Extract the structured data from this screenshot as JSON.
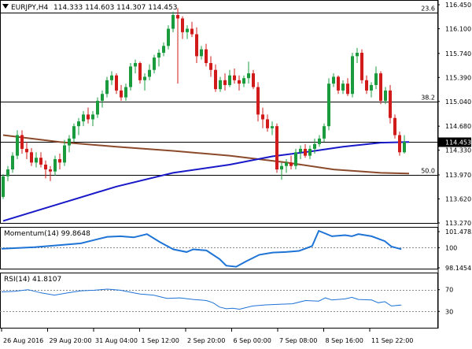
{
  "header": {
    "symbol": "EURJPY,H4",
    "ohlc": "114.333 114.603 114.307 114.453"
  },
  "colors": {
    "bull": "#1a9c3e",
    "bear": "#d11a1a",
    "ma_fast": "#1919c8",
    "ma_slow": "#8b4a2b",
    "indicator": "#1e73d6",
    "grid_line": "#000000",
    "dotted": "#8a8a8a",
    "price_tag_bg": "#000000",
    "price_tag_fg": "#ffffff"
  },
  "chart_data": [
    {
      "type": "candlestick",
      "panel": "price",
      "symbol": "EURJPY",
      "timeframe": "H4",
      "current_price": "114.453",
      "y_ticks": [
        "116.450",
        "116.100",
        "115.740",
        "115.390",
        "115.040",
        "114.680",
        "114.330",
        "113.970",
        "113.620",
        "113.270"
      ],
      "ylim": [
        113.27,
        116.45
      ],
      "x_ticks": [
        "26 Aug 2016",
        "29 Aug 20:00",
        "31 Aug 04:00",
        "1 Sep 12:00",
        "2 Sep 20:00",
        "6 Sep 00:00",
        "7 Sep 08:00",
        "8 Sep 16:00",
        "11 Sep 22:00"
      ],
      "fib_levels": [
        {
          "label": "23.6",
          "value": 116.33
        },
        {
          "label": "38.2",
          "value": 115.04
        },
        {
          "label": "50.0",
          "value": 113.97
        }
      ],
      "hline": 114.453,
      "candles": [
        [
          113.65,
          113.98,
          113.62,
          113.95
        ],
        [
          113.95,
          114.1,
          113.88,
          114.05
        ],
        [
          114.05,
          114.3,
          114.0,
          114.25
        ],
        [
          114.25,
          114.62,
          114.2,
          114.55
        ],
        [
          114.55,
          114.62,
          114.28,
          114.35
        ],
        [
          114.35,
          114.45,
          114.2,
          114.3
        ],
        [
          114.3,
          114.36,
          114.1,
          114.15
        ],
        [
          114.15,
          114.3,
          114.08,
          114.22
        ],
        [
          114.22,
          114.3,
          114.08,
          114.12
        ],
        [
          114.12,
          114.18,
          113.92,
          114.05
        ],
        [
          114.05,
          114.1,
          113.88,
          114.02
        ],
        [
          114.02,
          114.25,
          113.96,
          114.2
        ],
        [
          114.2,
          114.28,
          114.05,
          114.15
        ],
        [
          114.15,
          114.48,
          114.1,
          114.4
        ],
        [
          114.4,
          114.55,
          114.3,
          114.5
        ],
        [
          114.5,
          114.72,
          114.45,
          114.68
        ],
        [
          114.68,
          114.8,
          114.55,
          114.75
        ],
        [
          114.75,
          114.9,
          114.68,
          114.85
        ],
        [
          114.85,
          114.95,
          114.72,
          114.78
        ],
        [
          114.78,
          114.9,
          114.68,
          114.85
        ],
        [
          114.85,
          115.1,
          114.8,
          115.05
        ],
        [
          115.05,
          115.2,
          114.95,
          115.15
        ],
        [
          115.15,
          115.4,
          115.1,
          115.35
        ],
        [
          115.35,
          115.48,
          115.28,
          115.42
        ],
        [
          115.42,
          115.45,
          115.15,
          115.2
        ],
        [
          115.2,
          115.28,
          115.05,
          115.1
        ],
        [
          115.1,
          115.3,
          115.05,
          115.25
        ],
        [
          115.25,
          115.6,
          115.2,
          115.55
        ],
        [
          115.55,
          115.65,
          115.45,
          115.6
        ],
        [
          115.6,
          115.62,
          115.3,
          115.35
        ],
        [
          115.35,
          115.45,
          115.2,
          115.4
        ],
        [
          115.4,
          115.58,
          115.35,
          115.5
        ],
        [
          115.5,
          115.72,
          115.45,
          115.68
        ],
        [
          115.68,
          115.8,
          115.55,
          115.75
        ],
        [
          115.75,
          115.9,
          115.7,
          115.85
        ],
        [
          115.85,
          116.15,
          115.8,
          116.1
        ],
        [
          116.1,
          116.35,
          116.05,
          116.3
        ],
        [
          116.3,
          116.4,
          115.3,
          116.25
        ],
        [
          116.25,
          116.28,
          115.95,
          116.05
        ],
        [
          116.05,
          116.15,
          115.95,
          116.1
        ],
        [
          116.1,
          116.2,
          115.98,
          116.02
        ],
        [
          116.02,
          116.12,
          115.6,
          115.7
        ],
        [
          115.7,
          115.85,
          115.65,
          115.8
        ],
        [
          115.8,
          115.88,
          115.55,
          115.6
        ],
        [
          115.6,
          115.7,
          115.4,
          115.5
        ],
        [
          115.5,
          115.58,
          115.18,
          115.22
        ],
        [
          115.22,
          115.4,
          115.18,
          115.35
        ],
        [
          115.35,
          115.45,
          115.2,
          115.28
        ],
        [
          115.28,
          115.5,
          115.25,
          115.42
        ],
        [
          115.42,
          115.52,
          115.3,
          115.35
        ],
        [
          115.35,
          115.42,
          115.2,
          115.3
        ],
        [
          115.3,
          115.42,
          115.25,
          115.38
        ],
        [
          115.38,
          115.62,
          115.3,
          115.45
        ],
        [
          115.45,
          115.5,
          115.22,
          115.25
        ],
        [
          115.25,
          115.32,
          114.75,
          114.85
        ],
        [
          114.85,
          114.95,
          114.65,
          114.78
        ],
        [
          114.78,
          114.85,
          114.6,
          114.65
        ],
        [
          114.65,
          114.75,
          114.55,
          114.68
        ],
        [
          114.68,
          114.72,
          114.0,
          114.05
        ],
        [
          114.05,
          114.15,
          113.9,
          114.1
        ],
        [
          114.1,
          114.2,
          114.0,
          114.15
        ],
        [
          114.15,
          114.25,
          114.05,
          114.1
        ],
        [
          114.1,
          114.35,
          114.05,
          114.3
        ],
        [
          114.3,
          114.4,
          114.2,
          114.35
        ],
        [
          114.35,
          114.42,
          114.22,
          114.25
        ],
        [
          114.25,
          114.4,
          114.2,
          114.35
        ],
        [
          114.35,
          114.5,
          114.28,
          114.42
        ],
        [
          114.42,
          114.55,
          114.38,
          114.5
        ],
        [
          114.5,
          114.72,
          114.45,
          114.68
        ],
        [
          114.68,
          115.38,
          114.62,
          115.3
        ],
        [
          115.3,
          115.45,
          115.25,
          115.4
        ],
        [
          115.4,
          115.42,
          115.15,
          115.2
        ],
        [
          115.2,
          115.35,
          115.15,
          115.3
        ],
        [
          115.3,
          115.38,
          115.12,
          115.15
        ],
        [
          115.15,
          115.75,
          115.1,
          115.7
        ],
        [
          115.7,
          115.82,
          115.6,
          115.75
        ],
        [
          115.75,
          115.8,
          115.3,
          115.35
        ],
        [
          115.35,
          115.42,
          115.15,
          115.2
        ],
        [
          115.2,
          115.32,
          115.1,
          115.28
        ],
        [
          115.28,
          115.55,
          115.22,
          115.45
        ],
        [
          115.45,
          115.48,
          115.0,
          115.05
        ],
        [
          115.05,
          115.25,
          115.0,
          115.2
        ],
        [
          115.2,
          115.28,
          114.72,
          114.8
        ],
        [
          114.8,
          114.85,
          114.5,
          114.55
        ],
        [
          114.55,
          114.6,
          114.25,
          114.3
        ],
        [
          114.3,
          114.55,
          114.28,
          114.45
        ]
      ],
      "sma_fast": [
        [
          0,
          113.3
        ],
        [
          12,
          113.55
        ],
        [
          24,
          113.8
        ],
        [
          36,
          114.0
        ],
        [
          48,
          114.12
        ],
        [
          57,
          114.24
        ],
        [
          66,
          114.32
        ],
        [
          72,
          114.38
        ],
        [
          80,
          114.44
        ],
        [
          86,
          114.45
        ]
      ],
      "sma_slow": [
        [
          0,
          114.55
        ],
        [
          12,
          114.45
        ],
        [
          24,
          114.38
        ],
        [
          36,
          114.32
        ],
        [
          48,
          114.25
        ],
        [
          60,
          114.15
        ],
        [
          70,
          114.05
        ],
        [
          80,
          114.0
        ],
        [
          86,
          113.99
        ]
      ]
    },
    {
      "type": "line",
      "panel": "momentum",
      "label": "Momentum(14) 99.8648",
      "y_ticks": [
        "101.4785",
        "100",
        "98.1454"
      ],
      "ylim": [
        98.1454,
        101.4785
      ],
      "reference": 100,
      "values": [
        [
          0,
          99.9
        ],
        [
          10,
          100.05
        ],
        [
          18,
          100.25
        ],
        [
          24,
          100.4
        ],
        [
          28,
          100.7
        ],
        [
          32,
          101.0
        ],
        [
          36,
          101.05
        ],
        [
          40,
          100.95
        ],
        [
          44,
          101.25
        ],
        [
          48,
          100.5
        ],
        [
          52,
          99.85
        ],
        [
          56,
          99.6
        ],
        [
          58,
          99.85
        ],
        [
          62,
          99.75
        ],
        [
          66,
          98.95
        ],
        [
          68,
          98.35
        ],
        [
          71,
          98.25
        ],
        [
          74,
          98.75
        ],
        [
          78,
          99.35
        ],
        [
          82,
          99.55
        ],
        [
          86,
          99.6
        ],
        [
          90,
          99.7
        ],
        [
          94,
          100.15
        ],
        [
          96,
          101.55
        ],
        [
          100,
          101.05
        ],
        [
          104,
          101.15
        ],
        [
          106,
          101.05
        ],
        [
          108,
          101.25
        ],
        [
          112,
          101.05
        ],
        [
          116,
          100.6
        ],
        [
          118,
          100.1
        ],
        [
          121,
          99.86
        ]
      ]
    },
    {
      "type": "line",
      "panel": "rsi",
      "label": "RSI(14) 41.8107",
      "y_ticks": [
        "70",
        "30"
      ],
      "ylim": [
        0,
        100
      ],
      "levels": [
        70,
        30
      ],
      "values": [
        [
          0,
          66
        ],
        [
          4,
          67
        ],
        [
          8,
          70
        ],
        [
          12,
          64
        ],
        [
          16,
          60
        ],
        [
          20,
          64
        ],
        [
          24,
          68
        ],
        [
          28,
          69
        ],
        [
          32,
          71
        ],
        [
          36,
          69
        ],
        [
          40,
          64
        ],
        [
          42,
          62
        ],
        [
          46,
          60
        ],
        [
          50,
          54
        ],
        [
          54,
          55
        ],
        [
          58,
          52
        ],
        [
          62,
          50
        ],
        [
          64,
          46
        ],
        [
          66,
          38
        ],
        [
          68,
          35
        ],
        [
          70,
          36
        ],
        [
          72,
          34
        ],
        [
          76,
          40
        ],
        [
          80,
          42
        ],
        [
          84,
          43
        ],
        [
          88,
          44
        ],
        [
          92,
          50
        ],
        [
          96,
          49
        ],
        [
          98,
          55
        ],
        [
          100,
          51
        ],
        [
          104,
          53
        ],
        [
          106,
          56
        ],
        [
          108,
          52
        ],
        [
          112,
          51
        ],
        [
          114,
          46
        ],
        [
          116,
          48
        ],
        [
          118,
          40
        ],
        [
          121,
          41.8
        ]
      ]
    }
  ]
}
